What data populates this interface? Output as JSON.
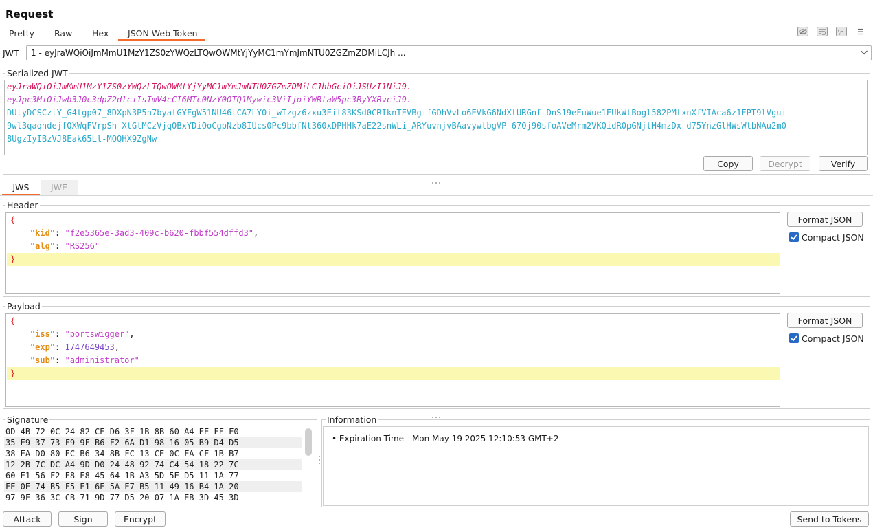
{
  "title": "Request",
  "tabs": [
    {
      "label": "Pretty"
    },
    {
      "label": "Raw"
    },
    {
      "label": "Hex"
    },
    {
      "label": "JSON Web Token",
      "active": true
    }
  ],
  "toolbar_icons": [
    "hide-whitespace-icon",
    "wrap-lines-icon",
    "newline-toggle-icon",
    "menu-icon"
  ],
  "jwt_selector": {
    "label": "JWT",
    "value": "1 - eyJraWQiOiJmMmU1MzY1ZS0zYWQzLTQwOWMtYjYyMC1mYmJmNTU0ZGZmZDMiLCJh ..."
  },
  "serialized": {
    "title": "Serialized JWT",
    "header_part": "eyJraWQiOiJmMmU1MzY1ZS0zYWQzLTQwOWMtYjYyMC1mYmJmNTU0ZGZmZDMiLCJhbGciOiJSUzI1NiJ9.",
    "payload_part": "eyJpc3MiOiJwb3J0c3dpZ2dlciIsImV4cCI6MTc0NzY0OTQ1Mywic3ViIjoiYWRtaW5pc3RyYXRvciJ9.",
    "signature_lines": [
      "DUtyDCSCztY_G4tgp07_8DXpN3P5n7byatGYFgW51NU46tCA7LY0i_wTzgz6zxu3Eit83KSd0CRIknTEVBgifGDhVvLo6EVkG6NdXtURGnf-DnS19eFuWue1EUkWtBogl582PMtxnXfVIAca6z1FPT9lVgui",
      "9wl3qaqhdejfQXWqFVrpSh-XtGtMCzVjqOBxYDiOoCgpNzb8IUcs0Pc9bbfNt360xDPHHk7aE22snWLi_ARYuvnjvBAavywtbgVP-67Qj90sfoAVeMrm2VKQidR0pGNjtM4mzDx-d75YnzGlHWsWtbNAu2m0",
      "8UgzIyIBzVJ8Eak65Ll-MOQHX9ZgNw"
    ],
    "buttons": {
      "copy": "Copy",
      "decrypt": "Decrypt",
      "verify": "Verify"
    }
  },
  "subtabs": [
    {
      "label": "JWS",
      "active": true
    },
    {
      "label": "JWE",
      "active": false
    }
  ],
  "header_section": {
    "title": "Header",
    "open": "{",
    "entries": [
      {
        "key": "\"kid\"",
        "value": "\"f2e5365e-3ad3-409c-b620-fbbf554dffd3\"",
        "sep": ","
      },
      {
        "key": "\"alg\"",
        "value": "\"RS256\"",
        "sep": ""
      }
    ],
    "close": "}",
    "format_button": "Format JSON",
    "compact_label": "Compact JSON",
    "compact_checked": true
  },
  "payload_section": {
    "title": "Payload",
    "open": "{",
    "entries": [
      {
        "key": "\"iss\"",
        "value": "\"portswigger\"",
        "sep": ","
      },
      {
        "key": "\"exp\"",
        "value": "1747649453",
        "sep": ","
      },
      {
        "key": "\"sub\"",
        "value": "\"administrator\"",
        "sep": ""
      }
    ],
    "close": "}",
    "format_button": "Format JSON",
    "compact_label": "Compact JSON",
    "compact_checked": true
  },
  "signature_section": {
    "title": "Signature",
    "hex_rows": [
      "0D 4B 72 0C 24 82 CE D6 3F 1B 8B 60 A4 EE FF F0",
      "35 E9 37 73 F9 9F B6 F2 6A D1 98 16 05 B9 D4 D5",
      "38 EA D0 80 EC B6 34 8B FC 13 CE 0C FA CF 1B B7",
      "12 2B 7C DC A4 9D D0 24 48 92 74 C4 54 18 22 7C",
      "60 E1 56 F2 E8 E8 45 64 1B A3 5D 5E D5 11 1A 77",
      "FE 0E 74 B5 F5 E1 6E 5A E7 B5 11 49 16 B4 1A 20",
      "97 9F 36 3C CB 71 9D 77 D5 20 07 1A EB 3D 45 3D"
    ]
  },
  "information_section": {
    "title": "Information",
    "items": [
      "• Expiration Time - Mon May 19 2025 12:10:53 GMT+2"
    ]
  },
  "bottom_buttons": {
    "attack": "Attack",
    "sign": "Sign",
    "encrypt": "Encrypt",
    "send_to_tokens": "Send to Tokens"
  },
  "colors": {
    "accent": "#f36b2b",
    "checkbox": "#2769c4",
    "line_highlight": "#fbf8b2",
    "jwt_header": "#d4115a",
    "jwt_payload": "#c13ec8",
    "jwt_signature": "#2aa9c9",
    "json_key": "#e38b12"
  }
}
